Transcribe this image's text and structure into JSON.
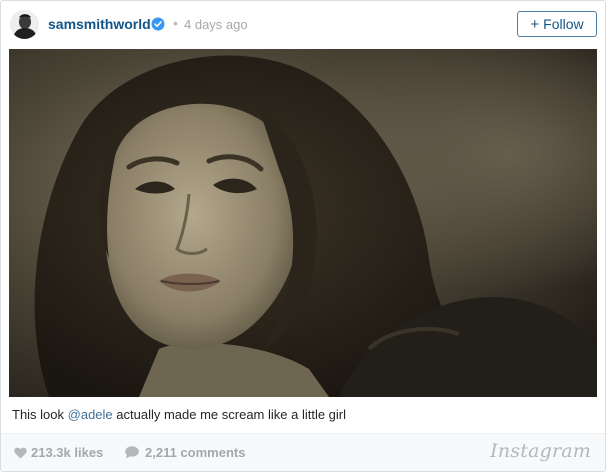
{
  "post": {
    "username": "samsmithworld",
    "separator": "•",
    "time": "4 days ago",
    "follow_label": "Follow",
    "follow_plus": "+",
    "caption_before": "This look ",
    "caption_mention": "@adele",
    "caption_after": " actually made me scream like a little girl",
    "likes": "213.3k likes",
    "comments": "2,211 comments",
    "brand": "Instagram"
  },
  "colors": {
    "link_blue": "#125688",
    "mention_blue": "#3f729b",
    "verified_blue": "#3897f0",
    "muted_gray": "#a5a7aa"
  },
  "icons": {
    "verified": "verified-badge-icon",
    "likes": "heart-icon",
    "comments": "speech-bubble-icon"
  }
}
